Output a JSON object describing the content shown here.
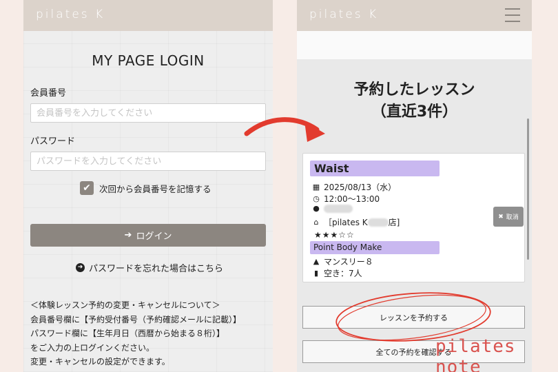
{
  "brand": {
    "logo": "pilates K"
  },
  "login": {
    "title": "MY PAGE LOGIN",
    "member_label": "会員番号",
    "member_placeholder": "会員番号を入力してください",
    "password_label": "パスワード",
    "password_placeholder": "パスワードを入力してください",
    "remember_label": "次回から会員番号を記憶する",
    "remember_checked": true,
    "login_button": "ログイン",
    "forgot_link": "パスワードを忘れた場合はこちら",
    "notice_lines": [
      "＜体験レッスン予約の変更・キャンセルについて＞",
      "会員番号欄に【予約受付番号（予約確認メールに記載）】",
      "パスワード欄に【生年月日（西暦から始まる８桁）】",
      "をご入力の上ログインください。",
      "変更・キャンセルの設定ができます。"
    ]
  },
  "reservations": {
    "title_line1": "予約したレッスン",
    "title_line2": "（直近3件）",
    "card": {
      "lesson_name": "Waist",
      "date": "2025/08/13（水）",
      "time": "12:00～13:00",
      "store_prefix": "［pilates K",
      "store_suffix": "店]",
      "stars": "★★★☆☆",
      "program": "Point Body Make",
      "plan": "マンスリー８",
      "availability": "空き：7人",
      "cancel_label": "取消"
    },
    "reserve_button": "レッスンを予約する",
    "all_button": "全ての予約を確認する"
  },
  "watermark": "pilates note",
  "colors": {
    "topbar": "#dcd3cb",
    "button_gray": "#8c8680",
    "lesson_highlight": "#c9b8f0",
    "annotation_red": "#e23b2e"
  },
  "icons": [
    "sign-in-icon",
    "arrow-circle-right-icon",
    "calendar-icon",
    "clock-icon",
    "user-icon",
    "home-icon",
    "road-icon",
    "bar-chart-icon",
    "close-icon",
    "hamburger-icon",
    "check-icon"
  ]
}
